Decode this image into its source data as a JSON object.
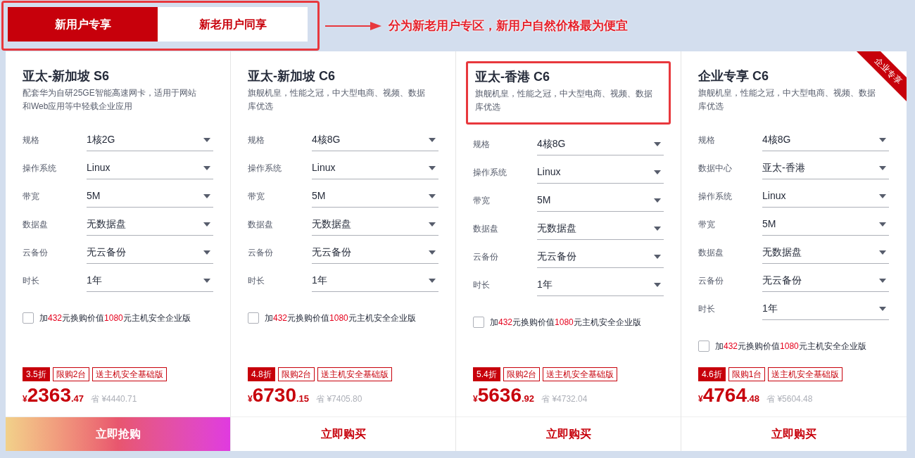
{
  "tabs": {
    "annotated": true,
    "items": [
      {
        "label": "新用户专享",
        "selected": true
      },
      {
        "label": "新老用户同享",
        "selected": false
      }
    ]
  },
  "callout": "分为新老用户专区，新用户自然价格最为便宜",
  "cards": [
    {
      "title": "亚太-新加坡 S6",
      "description": "配套华为自研25GE智能高速网卡，适用于网站和Web应用等中轻载企业应用",
      "annotated": false,
      "fields": [
        {
          "label": "规格",
          "value": "1核2G"
        },
        {
          "label": "操作系统",
          "value": "Linux"
        },
        {
          "label": "带宽",
          "value": "5M"
        },
        {
          "label": "数据盘",
          "value": "无数据盘"
        },
        {
          "label": "云备份",
          "value": "无云备份"
        },
        {
          "label": "时长",
          "value": "1年"
        }
      ],
      "addon": {
        "checked": false,
        "parts": [
          {
            "text": "加",
            "kind": "plain"
          },
          {
            "text": "432",
            "kind": "highlight"
          },
          {
            "text": "元换购价值",
            "kind": "plain"
          },
          {
            "text": "1080",
            "kind": "highlight"
          },
          {
            "text": "元主机安全企业版",
            "kind": "plain"
          }
        ]
      },
      "tags": [
        {
          "text": "3.5折",
          "kind": "solid"
        },
        {
          "text": "限购2台",
          "kind": "outline"
        },
        {
          "text": "送主机安全基础版",
          "kind": "outline"
        }
      ],
      "price": {
        "currency": "¥",
        "integer": "2363",
        "decimal": ".47",
        "savings": "省 ¥4440.71"
      },
      "button": {
        "label": "立即抢购",
        "kind": "flash"
      }
    },
    {
      "title": "亚太-新加坡 C6",
      "description": "旗舰机皇，性能之冠，中大型电商、视频、数据库优选",
      "annotated": false,
      "fields": [
        {
          "label": "规格",
          "value": "4核8G"
        },
        {
          "label": "操作系统",
          "value": "Linux"
        },
        {
          "label": "带宽",
          "value": "5M"
        },
        {
          "label": "数据盘",
          "value": "无数据盘"
        },
        {
          "label": "云备份",
          "value": "无云备份"
        },
        {
          "label": "时长",
          "value": "1年"
        }
      ],
      "addon": {
        "checked": false,
        "parts": [
          {
            "text": "加",
            "kind": "plain"
          },
          {
            "text": "432",
            "kind": "highlight"
          },
          {
            "text": "元换购价值",
            "kind": "plain"
          },
          {
            "text": "1080",
            "kind": "highlight"
          },
          {
            "text": "元主机安全企业版",
            "kind": "plain"
          }
        ]
      },
      "tags": [
        {
          "text": "4.8折",
          "kind": "solid"
        },
        {
          "text": "限购2台",
          "kind": "outline"
        },
        {
          "text": "送主机安全基础版",
          "kind": "outline"
        }
      ],
      "price": {
        "currency": "¥",
        "integer": "6730",
        "decimal": ".15",
        "savings": "省 ¥7405.80"
      },
      "button": {
        "label": "立即购买",
        "kind": "normal"
      }
    },
    {
      "title": "亚太-香港 C6",
      "description": "旗舰机皇，性能之冠，中大型电商、视频、数据库优选",
      "annotated": true,
      "fields": [
        {
          "label": "规格",
          "value": "4核8G"
        },
        {
          "label": "操作系统",
          "value": "Linux"
        },
        {
          "label": "带宽",
          "value": "5M"
        },
        {
          "label": "数据盘",
          "value": "无数据盘"
        },
        {
          "label": "云备份",
          "value": "无云备份"
        },
        {
          "label": "时长",
          "value": "1年"
        }
      ],
      "addon": {
        "checked": false,
        "parts": [
          {
            "text": "加",
            "kind": "plain"
          },
          {
            "text": "432",
            "kind": "highlight"
          },
          {
            "text": "元换购价值",
            "kind": "plain"
          },
          {
            "text": "1080",
            "kind": "highlight"
          },
          {
            "text": "元主机安全企业版",
            "kind": "plain"
          }
        ]
      },
      "tags": [
        {
          "text": "5.4折",
          "kind": "solid"
        },
        {
          "text": "限购2台",
          "kind": "outline"
        },
        {
          "text": "送主机安全基础版",
          "kind": "outline"
        }
      ],
      "price": {
        "currency": "¥",
        "integer": "5636",
        "decimal": ".92",
        "savings": "省 ¥4732.04"
      },
      "button": {
        "label": "立即购买",
        "kind": "normal"
      }
    },
    {
      "title": "企业专享 C6",
      "ribbon": "企业专享",
      "description": "旗舰机皇，性能之冠，中大型电商、视频、数据库优选",
      "annotated": false,
      "fields": [
        {
          "label": "规格",
          "value": "4核8G"
        },
        {
          "label": "数据中心",
          "value": "亚太-香港"
        },
        {
          "label": "操作系统",
          "value": "Linux"
        },
        {
          "label": "带宽",
          "value": "5M"
        },
        {
          "label": "数据盘",
          "value": "无数据盘"
        },
        {
          "label": "云备份",
          "value": "无云备份"
        },
        {
          "label": "时长",
          "value": "1年"
        }
      ],
      "addon": {
        "checked": false,
        "parts": [
          {
            "text": "加",
            "kind": "plain"
          },
          {
            "text": "432",
            "kind": "highlight"
          },
          {
            "text": "元换购价值",
            "kind": "plain"
          },
          {
            "text": "1080",
            "kind": "highlight"
          },
          {
            "text": "元主机安全企业版",
            "kind": "plain"
          }
        ]
      },
      "tags": [
        {
          "text": "4.6折",
          "kind": "solid"
        },
        {
          "text": "限购1台",
          "kind": "outline"
        },
        {
          "text": "送主机安全基础版",
          "kind": "outline"
        }
      ],
      "price": {
        "currency": "¥",
        "integer": "4764",
        "decimal": ".48",
        "savings": "省 ¥5604.48"
      },
      "button": {
        "label": "立即购买",
        "kind": "normal"
      }
    }
  ]
}
